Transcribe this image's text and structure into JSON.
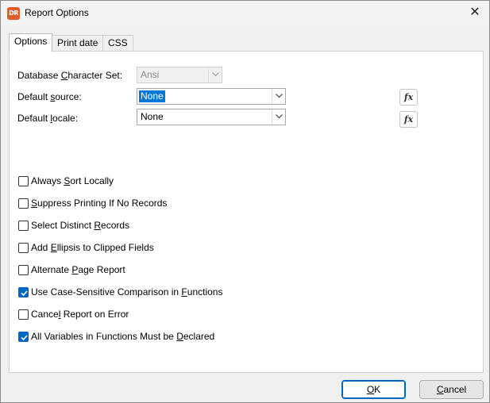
{
  "window": {
    "title": "Report Options",
    "app_icon_text": "DR",
    "close_symbol": "✕",
    "icons": {
      "app": "app-logo-icon",
      "close": "close-icon"
    }
  },
  "tabs": [
    {
      "label": "Options",
      "active": true
    },
    {
      "label": "Print date",
      "active": false
    },
    {
      "label": "CSS",
      "active": false
    }
  ],
  "fields": {
    "charset": {
      "label_pre": "Database ",
      "label_u": "C",
      "label_post": "haracter Set:",
      "value": "Ansi",
      "disabled": true
    },
    "source": {
      "label_pre": "Default ",
      "label_u": "s",
      "label_post": "ource:",
      "value": "None",
      "selected": true,
      "fx": "fx"
    },
    "locale": {
      "label_pre": "Default ",
      "label_u": "l",
      "label_post": "ocale:",
      "value": "None",
      "fx": "fx"
    }
  },
  "checkboxes": [
    {
      "pre": "Always ",
      "u": "S",
      "post": "ort Locally",
      "checked": false
    },
    {
      "pre": "",
      "u": "S",
      "post": "uppress Printing If No Records",
      "checked": false
    },
    {
      "pre": "Select Distinct ",
      "u": "R",
      "post": "ecords",
      "checked": false
    },
    {
      "pre": "Add ",
      "u": "E",
      "post": "llipsis to Clipped Fields",
      "checked": false
    },
    {
      "pre": "Alternate ",
      "u": "P",
      "post": "age Report",
      "checked": false
    },
    {
      "pre": "Use Case-Sensitive Comparison in ",
      "u": "F",
      "post": "unctions",
      "checked": true
    },
    {
      "pre": "Cance",
      "u": "l",
      "post": " Report on Error",
      "checked": false
    },
    {
      "pre": "All Variables in Functions Must be ",
      "u": "D",
      "post": "eclared",
      "checked": true
    }
  ],
  "buttons": {
    "ok": {
      "u": "O",
      "post": "K"
    },
    "cancel": {
      "pre": "",
      "u": "C",
      "post": "ancel"
    }
  }
}
